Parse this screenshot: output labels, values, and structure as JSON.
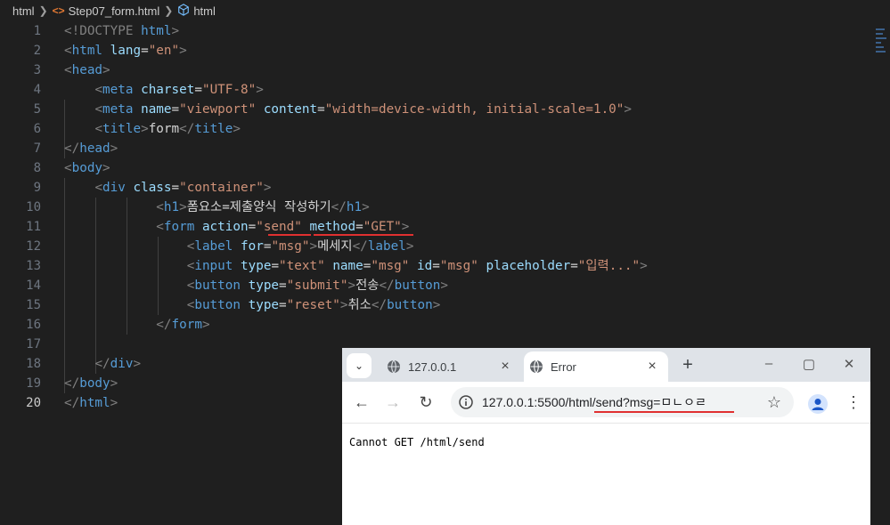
{
  "breadcrumb": {
    "folder": "html",
    "file": "Step07_form.html",
    "symbol": "html"
  },
  "editor": {
    "active_line": 20,
    "lines": [
      {
        "n": "1",
        "parts": [
          {
            "c": "t-br",
            "t": "<!DOCTYPE "
          },
          {
            "c": "t-tag",
            "t": "html"
          },
          {
            "c": "t-br",
            "t": ">"
          }
        ]
      },
      {
        "n": "2",
        "parts": [
          {
            "c": "t-br",
            "t": "<"
          },
          {
            "c": "t-tag",
            "t": "html"
          },
          {
            "c": "t-txt",
            "t": " "
          },
          {
            "c": "t-attr",
            "t": "lang"
          },
          {
            "c": "t-txt",
            "t": "="
          },
          {
            "c": "t-str",
            "t": "\"en\""
          },
          {
            "c": "t-br",
            "t": ">"
          }
        ]
      },
      {
        "n": "3",
        "parts": [
          {
            "c": "t-br",
            "t": "<"
          },
          {
            "c": "t-tag",
            "t": "head"
          },
          {
            "c": "t-br",
            "t": ">"
          }
        ]
      },
      {
        "n": "4",
        "parts": [
          {
            "c": "t-txt",
            "t": "    "
          },
          {
            "c": "t-br",
            "t": "<"
          },
          {
            "c": "t-tag",
            "t": "meta"
          },
          {
            "c": "t-txt",
            "t": " "
          },
          {
            "c": "t-attr",
            "t": "charset"
          },
          {
            "c": "t-txt",
            "t": "="
          },
          {
            "c": "t-str",
            "t": "\"UTF-8\""
          },
          {
            "c": "t-br",
            "t": ">"
          }
        ]
      },
      {
        "n": "5",
        "parts": [
          {
            "c": "t-txt",
            "t": "    "
          },
          {
            "c": "t-br",
            "t": "<"
          },
          {
            "c": "t-tag",
            "t": "meta"
          },
          {
            "c": "t-txt",
            "t": " "
          },
          {
            "c": "t-attr",
            "t": "name"
          },
          {
            "c": "t-txt",
            "t": "="
          },
          {
            "c": "t-str",
            "t": "\"viewport\""
          },
          {
            "c": "t-txt",
            "t": " "
          },
          {
            "c": "t-attr",
            "t": "content"
          },
          {
            "c": "t-txt",
            "t": "="
          },
          {
            "c": "t-str",
            "t": "\"width=device-width, initial-scale=1.0\""
          },
          {
            "c": "t-br",
            "t": ">"
          }
        ]
      },
      {
        "n": "6",
        "parts": [
          {
            "c": "t-txt",
            "t": "    "
          },
          {
            "c": "t-br",
            "t": "<"
          },
          {
            "c": "t-tag",
            "t": "title"
          },
          {
            "c": "t-br",
            "t": ">"
          },
          {
            "c": "t-txt",
            "t": "form"
          },
          {
            "c": "t-br",
            "t": "</"
          },
          {
            "c": "t-tag",
            "t": "title"
          },
          {
            "c": "t-br",
            "t": ">"
          }
        ]
      },
      {
        "n": "7",
        "parts": [
          {
            "c": "t-br",
            "t": "</"
          },
          {
            "c": "t-tag",
            "t": "head"
          },
          {
            "c": "t-br",
            "t": ">"
          }
        ]
      },
      {
        "n": "8",
        "parts": [
          {
            "c": "t-br",
            "t": "<"
          },
          {
            "c": "t-tag",
            "t": "body"
          },
          {
            "c": "t-br",
            "t": ">"
          }
        ]
      },
      {
        "n": "9",
        "parts": [
          {
            "c": "t-txt",
            "t": "    "
          },
          {
            "c": "t-br",
            "t": "<"
          },
          {
            "c": "t-tag",
            "t": "div"
          },
          {
            "c": "t-txt",
            "t": " "
          },
          {
            "c": "t-attr",
            "t": "class"
          },
          {
            "c": "t-txt",
            "t": "="
          },
          {
            "c": "t-str",
            "t": "\"container\""
          },
          {
            "c": "t-br",
            "t": ">"
          }
        ]
      },
      {
        "n": "10",
        "parts": [
          {
            "c": "t-txt",
            "t": "            "
          },
          {
            "c": "t-br",
            "t": "<"
          },
          {
            "c": "t-tag",
            "t": "h1"
          },
          {
            "c": "t-br",
            "t": ">"
          },
          {
            "c": "t-txt",
            "t": "폼요소=제출양식 작성하기"
          },
          {
            "c": "t-br",
            "t": "</"
          },
          {
            "c": "t-tag",
            "t": "h1"
          },
          {
            "c": "t-br",
            "t": ">"
          }
        ]
      },
      {
        "n": "11",
        "parts": [
          {
            "c": "t-txt",
            "t": "            "
          },
          {
            "c": "t-br",
            "t": "<"
          },
          {
            "c": "t-tag",
            "t": "form"
          },
          {
            "c": "t-txt",
            "t": " "
          },
          {
            "c": "t-attr",
            "t": "action"
          },
          {
            "c": "t-txt",
            "t": "="
          },
          {
            "c": "t-str",
            "t": "\"send\""
          },
          {
            "c": "t-txt",
            "t": " "
          },
          {
            "c": "t-attr",
            "t": "method"
          },
          {
            "c": "t-txt",
            "t": "="
          },
          {
            "c": "t-str",
            "t": "\"GET\""
          },
          {
            "c": "t-br",
            "t": ">"
          }
        ]
      },
      {
        "n": "12",
        "parts": [
          {
            "c": "t-txt",
            "t": "                "
          },
          {
            "c": "t-br",
            "t": "<"
          },
          {
            "c": "t-tag",
            "t": "label"
          },
          {
            "c": "t-txt",
            "t": " "
          },
          {
            "c": "t-attr",
            "t": "for"
          },
          {
            "c": "t-txt",
            "t": "="
          },
          {
            "c": "t-str",
            "t": "\"msg\""
          },
          {
            "c": "t-br",
            "t": ">"
          },
          {
            "c": "t-txt",
            "t": "메세지"
          },
          {
            "c": "t-br",
            "t": "</"
          },
          {
            "c": "t-tag",
            "t": "label"
          },
          {
            "c": "t-br",
            "t": ">"
          }
        ]
      },
      {
        "n": "13",
        "parts": [
          {
            "c": "t-txt",
            "t": "                "
          },
          {
            "c": "t-br",
            "t": "<"
          },
          {
            "c": "t-tag",
            "t": "input"
          },
          {
            "c": "t-txt",
            "t": " "
          },
          {
            "c": "t-attr",
            "t": "type"
          },
          {
            "c": "t-txt",
            "t": "="
          },
          {
            "c": "t-str",
            "t": "\"text\""
          },
          {
            "c": "t-txt",
            "t": " "
          },
          {
            "c": "t-attr",
            "t": "name"
          },
          {
            "c": "t-txt",
            "t": "="
          },
          {
            "c": "t-str",
            "t": "\"msg\""
          },
          {
            "c": "t-txt",
            "t": " "
          },
          {
            "c": "t-attr",
            "t": "id"
          },
          {
            "c": "t-txt",
            "t": "="
          },
          {
            "c": "t-str",
            "t": "\"msg\""
          },
          {
            "c": "t-txt",
            "t": " "
          },
          {
            "c": "t-attr",
            "t": "placeholder"
          },
          {
            "c": "t-txt",
            "t": "="
          },
          {
            "c": "t-str",
            "t": "\"입력...\""
          },
          {
            "c": "t-br",
            "t": ">"
          }
        ]
      },
      {
        "n": "14",
        "parts": [
          {
            "c": "t-txt",
            "t": "                "
          },
          {
            "c": "t-br",
            "t": "<"
          },
          {
            "c": "t-tag",
            "t": "button"
          },
          {
            "c": "t-txt",
            "t": " "
          },
          {
            "c": "t-attr",
            "t": "type"
          },
          {
            "c": "t-txt",
            "t": "="
          },
          {
            "c": "t-str",
            "t": "\"submit\""
          },
          {
            "c": "t-br",
            "t": ">"
          },
          {
            "c": "t-txt",
            "t": "전송"
          },
          {
            "c": "t-br",
            "t": "</"
          },
          {
            "c": "t-tag",
            "t": "button"
          },
          {
            "c": "t-br",
            "t": ">"
          }
        ]
      },
      {
        "n": "15",
        "parts": [
          {
            "c": "t-txt",
            "t": "                "
          },
          {
            "c": "t-br",
            "t": "<"
          },
          {
            "c": "t-tag",
            "t": "button"
          },
          {
            "c": "t-txt",
            "t": " "
          },
          {
            "c": "t-attr",
            "t": "type"
          },
          {
            "c": "t-txt",
            "t": "="
          },
          {
            "c": "t-str",
            "t": "\"reset\""
          },
          {
            "c": "t-br",
            "t": ">"
          },
          {
            "c": "t-txt",
            "t": "취소"
          },
          {
            "c": "t-br",
            "t": "</"
          },
          {
            "c": "t-tag",
            "t": "button"
          },
          {
            "c": "t-br",
            "t": ">"
          }
        ]
      },
      {
        "n": "16",
        "parts": [
          {
            "c": "t-txt",
            "t": "            "
          },
          {
            "c": "t-br",
            "t": "</"
          },
          {
            "c": "t-tag",
            "t": "form"
          },
          {
            "c": "t-br",
            "t": ">"
          }
        ]
      },
      {
        "n": "17",
        "parts": []
      },
      {
        "n": "18",
        "parts": [
          {
            "c": "t-txt",
            "t": "    "
          },
          {
            "c": "t-br",
            "t": "</"
          },
          {
            "c": "t-tag",
            "t": "div"
          },
          {
            "c": "t-br",
            "t": ">"
          }
        ]
      },
      {
        "n": "19",
        "parts": [
          {
            "c": "t-br",
            "t": "</"
          },
          {
            "c": "t-tag",
            "t": "body"
          },
          {
            "c": "t-br",
            "t": ">"
          }
        ]
      },
      {
        "n": "20",
        "parts": [
          {
            "c": "t-br",
            "t": "</"
          },
          {
            "c": "t-tag",
            "t": "html"
          },
          {
            "c": "t-br",
            "t": ">"
          }
        ]
      }
    ]
  },
  "browser": {
    "tabs": [
      {
        "title": "127.0.0.1",
        "active": false
      },
      {
        "title": "Error",
        "active": true
      }
    ],
    "address": "127.0.0.1:5500/html/send?msg=ㅁㄴㅇㄹ",
    "page_text": "Cannot GET /html/send"
  },
  "colors": {
    "underline": "#e03030",
    "editor_bg": "#1f1f1f"
  }
}
